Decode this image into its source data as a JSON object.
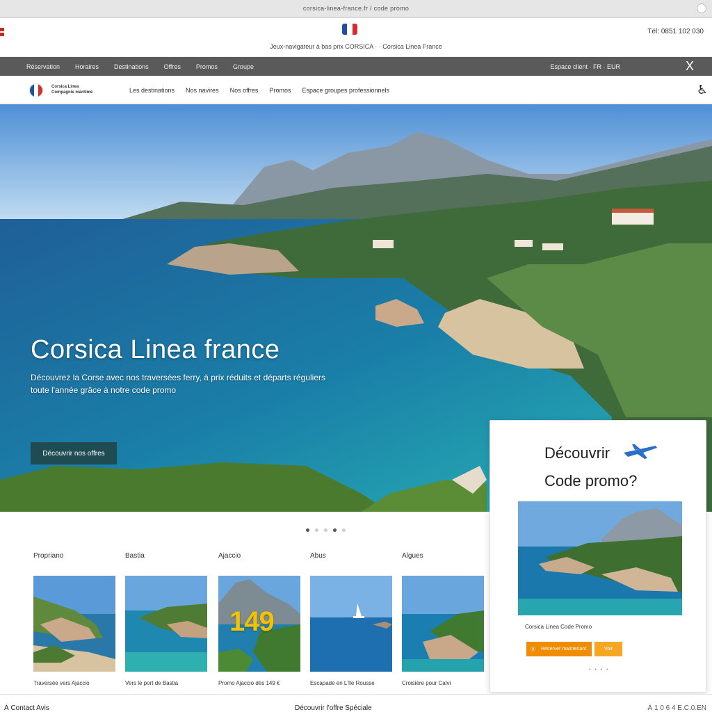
{
  "browser": {
    "url": "corsica-linea-france.fr / code promo"
  },
  "topbar": {
    "tagline": "Jeux-navigateur à bas prix CORSICA · · Corsica Linea France",
    "phone": "Tél: 0851 102 030"
  },
  "navbar": {
    "items": [
      "Réservation",
      "Horaires",
      "Destinations",
      "Offres",
      "Promos",
      "Groupe"
    ],
    "right": "Espace client · FR · EUR",
    "close": "X"
  },
  "subnav": {
    "brand_line1": "Corsica Linea",
    "brand_line2": "Compagnie maritime",
    "links": [
      "Les destinations",
      "Nos navires",
      "Nos offres",
      "Promos",
      "Espace groupes professionnels"
    ]
  },
  "hero": {
    "title": "Corsica Linea  france",
    "desc_line1": "Découvrez la Corse avec nos traversées ferry, à prix réduits et départs réguliers",
    "desc_line2": "toute l'année grâce à notre code promo",
    "cta": "Découvrir nos offres"
  },
  "promo": {
    "title1": "Découvrir",
    "title2": "Code promo?",
    "caption": "Corsica Linea Code Promo",
    "button1": "Réserver maintenant",
    "button2": "Voir",
    "dots": "• • • •"
  },
  "cards": [
    {
      "title": "Propriano",
      "subtitle": "Traversée vers Ajaccio"
    },
    {
      "title": "Bastia",
      "subtitle": "Vers le port de Bastia"
    },
    {
      "title": "Ajaccio",
      "subtitle": "Promo Ajaccio dès 149 €",
      "price": "149"
    },
    {
      "title": "Abus",
      "subtitle": "Escapade en L'île Rousse"
    },
    {
      "title": "Algues",
      "subtitle": "Croisière pour Calvi"
    }
  ],
  "footer": {
    "left": "À Contact Avis",
    "middle": "Découvrir l'offre Spéciale",
    "right": "À 1 0 6 4 E.C.0.EN"
  },
  "colors": {
    "nav_bg": "#5a5a5a",
    "cta_bg": "#1f4b53",
    "promo_orange": "#f08c00",
    "price_yellow": "#f2c100"
  }
}
